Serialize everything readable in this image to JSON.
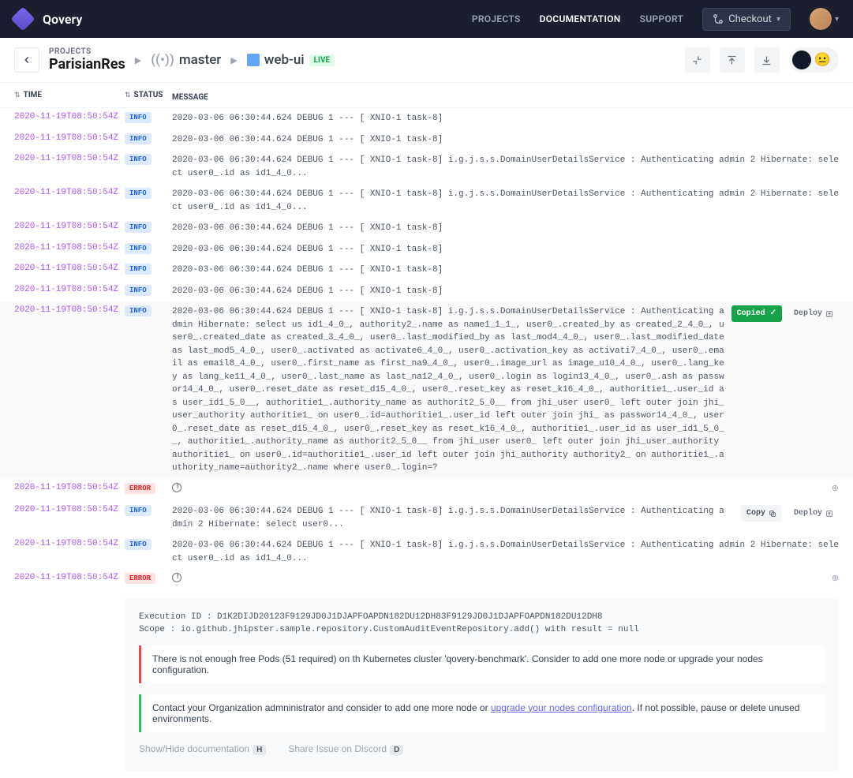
{
  "brand": "Qovery",
  "nav": {
    "projects": "PROJECTS",
    "documentation": "DOCUMENTATION",
    "support": "SUPPORT"
  },
  "checkout": "Checkout",
  "breadcrumb": {
    "projects_label": "PROJECTS",
    "project": "ParisianRes",
    "branch": "master",
    "app": "web-ui",
    "live": "LIVE"
  },
  "columns": {
    "time": "TIME",
    "status": "STATUS",
    "message": "MESSAGE"
  },
  "logs": [
    {
      "time": "2020-11-19T08:50:54Z",
      "status": "INFO",
      "msg": "2020-03-06 06:30:44.624 DEBUG 1 --- [  XNIO-1 task-8]"
    },
    {
      "time": "2020-11-19T08:50:54Z",
      "status": "INFO",
      "msg": "2020-03-06 06:30:44.624 DEBUG 1 --- [  XNIO-1 task-8]"
    },
    {
      "time": "2020-11-19T08:50:54Z",
      "status": "INFO",
      "msg": "2020-03-06 06:30:44.624 DEBUG 1 --- [  XNIO-1 task-8] i.g.j.s.s.DomainUserDetailsService : Authenticating admin 2 Hibernate: select user0_.id as id1_4_0..."
    },
    {
      "time": "2020-11-19T08:50:54Z",
      "status": "INFO",
      "msg": "2020-03-06 06:30:44.624 DEBUG 1 --- [  XNIO-1 task-8] i.g.j.s.s.DomainUserDetailsService : Authenticating admin 2 Hibernate: select user0_.id as id1_4_0..."
    },
    {
      "time": "2020-11-19T08:50:54Z",
      "status": "INFO",
      "msg": "2020-03-06 06:30:44.624 DEBUG 1 --- [  XNIO-1 task-8]"
    },
    {
      "time": "2020-11-19T08:50:54Z",
      "status": "INFO",
      "msg": "2020-03-06 06:30:44.624 DEBUG 1 --- [  XNIO-1 task-8]"
    },
    {
      "time": "2020-11-19T08:50:54Z",
      "status": "INFO",
      "msg": "2020-03-06 06:30:44.624 DEBUG 1 --- [  XNIO-1 task-8]"
    },
    {
      "time": "2020-11-19T08:50:54Z",
      "status": "INFO",
      "msg": "2020-03-06 06:30:44.624 DEBUG 1 --- [  XNIO-1 task-8]"
    },
    {
      "time": "2020-11-19T08:50:54Z",
      "status": "INFO",
      "msg": "2020-03-06 06:30:44.624 DEBUG 1 --- [  XNIO-1 task-8] i.g.j.s.s.DomainUserDetailsService      : Authenticating admin Hibernate: select us     id1_4_0_, authority2_.name as name1_1_1_, user0_.created_by as created_2_4_0_, user0_.created_date as created_3_4_0_, user0_.last_modified_by as last_mod4_4_0_, user0_.last_modified_date as last_mod5_4_0_, user0_.activated as activate6_4_0_, user0_.activation_key as activati7_4_0_, user0_.email as email8_4_0_, user0_.first_name as first_na9_4_0_, user0_.image_url as image_u10_4_0_, user0_.lang_key as lang_ke11_4_0_, user0_.last_name as last_na12_4_0_, user0_.login as login13_4_0_, user0_.ash as passwor14_4_0_, user0_.reset_date as reset_d15_4_0_, user0_.reset_key as reset_k16_4_0_, authoritie1_.user_id as user_id1_5_0__, authoritie1_.authority_name as authorit2_5_0__ from jhi_user user0_ left outer join jhi_user_authority authoritie1_ on user0_.id=authoritie1_.user_id left outer join jhi_ as passwor14_4_0_, user0_.reset_date as reset_d15_4_0_, user0_.reset_key as reset_k16_4_0_, authoritie1_.user_id as user_id1_5_0__, authoritie1_.authority_name as authorit2_5_0__ from jhi_user user0_ left outer join jhi_user_authority authoritie1_ on user0_.id=authoritie1_.user_id left outer join jhi_authority authority2_ on authoritie1_.authority_name=authority2_.name where user0_.login=?",
      "actions": {
        "copied": "Copied",
        "deploy": "Deploy"
      }
    },
    {
      "time": "2020-11-19T08:50:54Z",
      "status": "ERROR",
      "msg": ""
    },
    {
      "time": "2020-11-19T08:50:54Z",
      "status": "INFO",
      "msg": "2020-03-06 06:30:44.624 DEBUG 1 --- [  XNIO-1 task-8] i.g.j.s.s.DomainUserDetailsService : Authenticating admin 2 Hibernate: select user0...",
      "actions": {
        "copy": "Copy",
        "deploy": "Deploy"
      }
    },
    {
      "time": "2020-11-19T08:50:54Z",
      "status": "INFO",
      "msg": "2020-03-06 06:30:44.624 DEBUG 1 --- [  XNIO-1 task-8] i.g.j.s.s.DomainUserDetailsService : Authenticating admin 2 Hibernate: select user0_.id as id1_4_0..."
    },
    {
      "time": "2020-11-19T08:50:54Z",
      "status": "ERROR",
      "msg": ""
    }
  ],
  "detail": {
    "exec_id": "Execution ID : D1K2DIJD20123F9129JD0J1DJAPFOAPDN182DU12DH83F9129JD0J1DJAPFOAPDN182DU12DH8",
    "scope": "Scope : io.github.jhipster.sample.repository.CustomAuditEventRepository.add() with result = null",
    "alert_red": "There  is not enough free Pods (51 required) on th Kubernetes cluster 'qovery-benchmark'. Consider to add one more node or upgrade your nodes configuration.",
    "alert_green_pre": "Contact your Organization admninistrator and consider to add one more node or ",
    "alert_green_link": "upgrade your nodes configuration",
    "alert_green_post": ". If not possible, pause or delete unused environments.",
    "help_doc": "Show/Hide  documentation",
    "help_doc_key": "H",
    "help_discord": "Share Issue on Discord",
    "help_discord_key": "D"
  }
}
